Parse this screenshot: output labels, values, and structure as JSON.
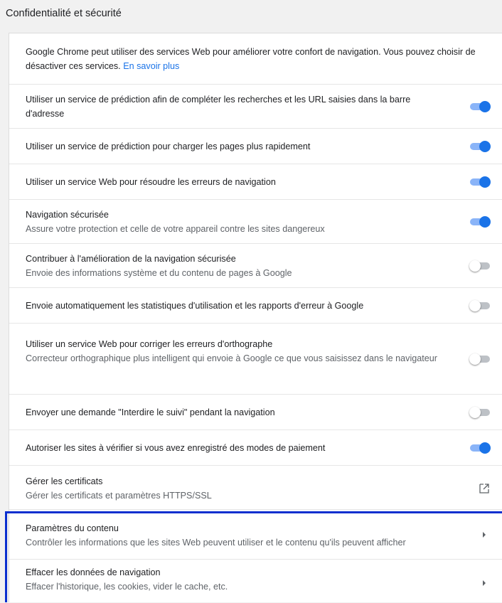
{
  "section_title": "Confidentialité et sécurité",
  "intro": {
    "text": "Google Chrome peut utiliser des services Web pour améliorer votre confort de navigation. Vous pouvez choisir de désactiver ces services.",
    "link_label": "En savoir plus"
  },
  "settings": [
    {
      "title": "Utiliser un service de prédiction afin de compléter les recherches et les URL saisies dans la barre d'adresse",
      "subtitle": "",
      "control": "toggle",
      "enabled": true
    },
    {
      "title": "Utiliser un service de prédiction pour charger les pages plus rapidement",
      "subtitle": "",
      "control": "toggle",
      "enabled": true
    },
    {
      "title": "Utiliser un service Web pour résoudre les erreurs de navigation",
      "subtitle": "",
      "control": "toggle",
      "enabled": true
    },
    {
      "title": "Navigation sécurisée",
      "subtitle": "Assure votre protection et celle de votre appareil contre les sites dangereux",
      "control": "toggle",
      "enabled": true
    },
    {
      "title": "Contribuer à l'amélioration de la navigation sécurisée",
      "subtitle": "Envoie des informations système et du contenu de pages à Google",
      "control": "toggle",
      "enabled": false
    },
    {
      "title": "Envoie automatiquement les statistiques d'utilisation et les rapports d'erreur à Google",
      "subtitle": "",
      "control": "toggle",
      "enabled": false
    },
    {
      "title": "Utiliser un service Web pour corriger les erreurs d'orthographe",
      "subtitle": "Correcteur orthographique plus intelligent qui envoie à Google ce que vous saisissez dans le navigateur",
      "control": "toggle",
      "enabled": false
    },
    {
      "title": "Envoyer une demande \"Interdire le suivi\" pendant la navigation",
      "subtitle": "",
      "control": "toggle",
      "enabled": false
    },
    {
      "title": "Autoriser les sites à vérifier si vous avez enregistré des modes de paiement",
      "subtitle": "",
      "control": "toggle",
      "enabled": true
    },
    {
      "title": "Gérer les certificats",
      "subtitle": "Gérer les certificats et paramètres HTTPS/SSL",
      "control": "external-link-icon"
    },
    {
      "title": "Paramètres du contenu",
      "subtitle": "Contrôler les informations que les sites Web peuvent utiliser et le contenu qu'ils peuvent afficher",
      "control": "chevron-right-icon"
    },
    {
      "title": "Effacer les données de navigation",
      "subtitle": "Effacer l'historique, les cookies, vider le cache, etc.",
      "control": "chevron-right-icon"
    }
  ],
  "colors": {
    "toggle_on": "#1a73e8",
    "link": "#1a73e8",
    "highlight": "#0a2fcf"
  }
}
